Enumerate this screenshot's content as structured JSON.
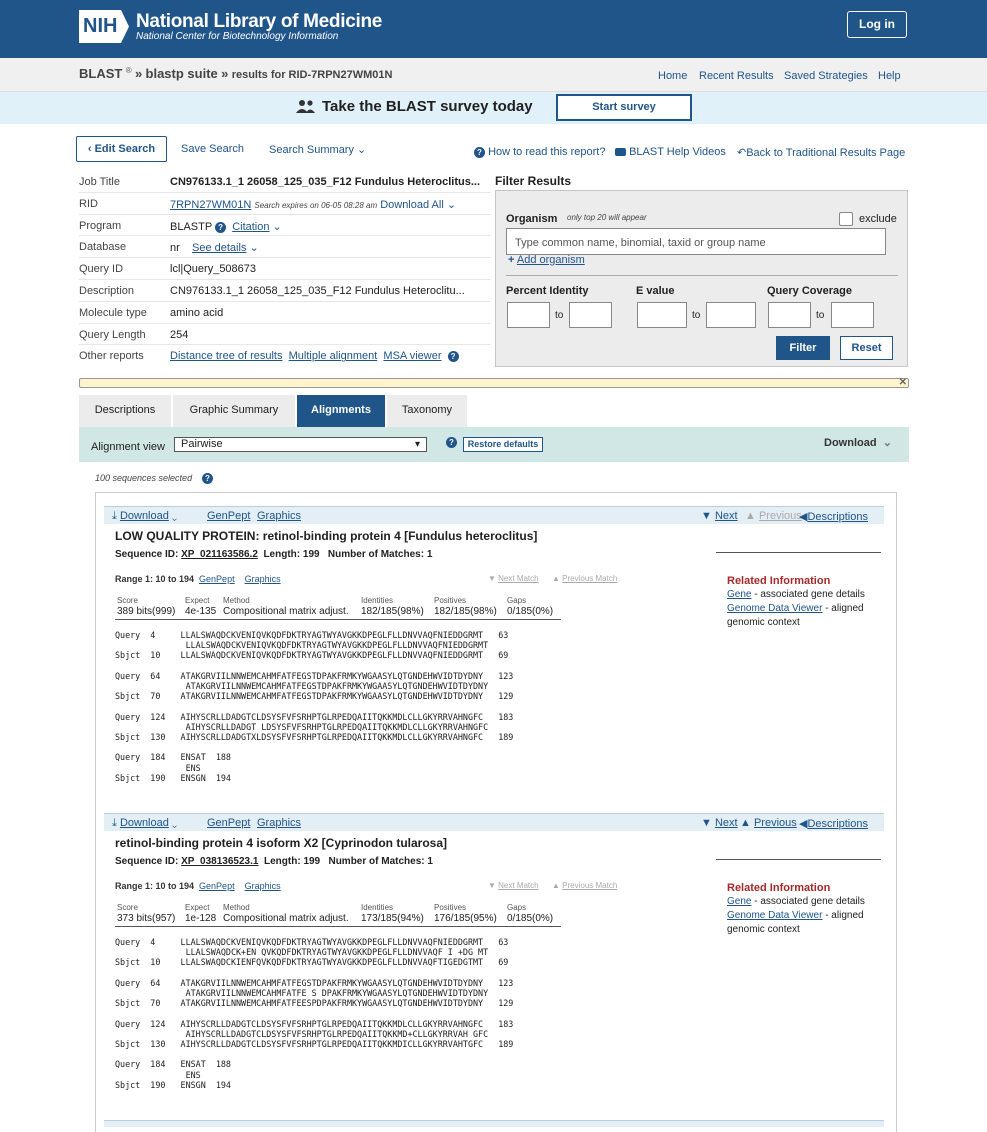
{
  "header": {
    "logo": "NIH",
    "title": "National Library of Medicine",
    "subtitle": "National Center for Biotechnology Information",
    "login": "Log in"
  },
  "breadcrumb": {
    "blast": "BLAST",
    "reg": "®",
    "sep1": "»",
    "suite": "blastp suite",
    "sep2": "»",
    "results": "results for RID-7RPN27WM01N"
  },
  "topnav": [
    "Home",
    "Recent Results",
    "Saved Strategies",
    "Help"
  ],
  "survey": {
    "text": "Take the BLAST survey today",
    "button": "Start survey"
  },
  "actions": {
    "edit": "‹ Edit Search",
    "save": "Save Search",
    "summary": "Search Summary",
    "howto": "How to read this report?",
    "videos": "BLAST Help Videos",
    "traditional": "Back to Traditional Results Page"
  },
  "job": {
    "labels": [
      "Job Title",
      "RID",
      "Program",
      "Database",
      "Query ID",
      "Description",
      "Molecule type",
      "Query Length",
      "Other reports"
    ],
    "title": "CN976133.1_1 26058_125_035_F12 Fundulus Heteroclitus...",
    "rid": "7RPN27WM01N",
    "rid_note": "Search expires on 06-05 08:28 am",
    "download_all": "Download All",
    "program": "BLASTP",
    "citation": "Citation",
    "database": "nr",
    "see_details": "See details",
    "query_id": "lcl|Query_508673",
    "description": "CN976133.1_1 26058_125_035_F12 Fundulus Heteroclitu...",
    "molecule": "amino acid",
    "length": "254",
    "reports": [
      "Distance tree of results",
      "Multiple alignment",
      "MSA viewer"
    ]
  },
  "filter": {
    "title": "Filter Results",
    "organism": "Organism",
    "top20": "only top 20 will appear",
    "exclude": "exclude",
    "placeholder": "Type common  name, binomial, taxid or group  name",
    "add": "Add organism",
    "identity": "Percent Identity",
    "evalue": "E value",
    "coverage": "Query Coverage",
    "to": "to",
    "filter_btn": "Filter",
    "reset_btn": "Reset"
  },
  "tabs": [
    "Descriptions",
    "Graphic Summary",
    "Alignments",
    "Taxonomy"
  ],
  "alignment_view": {
    "label": "Alignment view",
    "value": "Pairwise",
    "restore": "Restore defaults",
    "download": "Download"
  },
  "selected": "100 sequences selected",
  "hits": [
    {
      "download": "Download",
      "genpept": "GenPept",
      "graphics": "Graphics",
      "next": "Next",
      "previous": "Previous",
      "descriptions": "Descriptions",
      "title": "LOW QUALITY PROTEIN: retinol-binding protein 4 [Fundulus heteroclitus]",
      "seqid_label": "Sequence ID:",
      "seqid": "XP_021163586.2",
      "length_label": "Length:",
      "length": "199",
      "matches_label": "Number of Matches:",
      "matches": "1",
      "range": "Range 1: 10 to 194",
      "next_match": "Next Match",
      "prev_match": "Previous Match",
      "score_hdr": [
        "Score",
        "Expect",
        "Method",
        "Identities",
        "Positives",
        "Gaps"
      ],
      "score_val": [
        "389 bits(999)",
        "4e-135",
        "Compositional matrix adjust.",
        "182/185(98%)",
        "182/185(98%)",
        "0/185(0%)"
      ],
      "related": {
        "title": "Related Information",
        "gene": "Gene",
        "gene_desc": "- associated gene details",
        "gdv": "Genome Data Viewer",
        "gdv_desc": "- aligned genomic context"
      },
      "alignment": "Query  4     LLALSWAQDCKVENIQVKQDFDKTRYAGTWYAVGKKDPEGLFLLDNVVAQFNIEDDGRMT   63\n              LLALSWAQDCKVENIQVKQDFDKTRYAGTWYAVGKKDPEGLFLLDNVVAQFNIEDDGRMT\nSbjct  10    LLALSWAQDCKVENIQVKQDFDKTRYAGTWYAVGKKDPEGLFLLDNVVAQFNIEDDGRMT   69\n\nQuery  64    ATAKGRVIILNNWEMCAHMFATFEGSTDPAKFRMKYWGAASYLQTGNDEHWVIDTDYDNY   123\n              ATAKGRVIILNNWEMCAHMFATFEGSTDPAKFRMKYWGAASYLQTGNDEHWVIDTDYDNY\nSbjct  70    ATAKGRVIILNNWEMCAHMFATFEGSTDPAKFRMKYWGAASYLQTGNDEHWVIDTDYDNY   129\n\nQuery  124   AIHYSCRLLDADGTCLDSYSFVFSRHPTGLRPEDQAIITQKKMDLCLLGKYRRVAHNGFC   183\n              AIHYSCRLLDADGT LDSYSFVFSRHPTGLRPEDQAIITQKKMDLCLLGKYRRVAHNGFC\nSbjct  130   AIHYSCRLLDADGTXLDSYSFVFSRHPTGLRPEDQAIITQKKMDLCLLGKYRRVAHNGFC   189\n\nQuery  184   ENSAT  188\n              ENS\nSbjct  190   ENSGN  194"
    },
    {
      "download": "Download",
      "genpept": "GenPept",
      "graphics": "Graphics",
      "next": "Next",
      "previous": "Previous",
      "descriptions": "Descriptions",
      "title": "retinol-binding protein 4 isoform X2 [Cyprinodon tularosa]",
      "seqid_label": "Sequence ID:",
      "seqid": "XP_038136523.1",
      "length_label": "Length:",
      "length": "199",
      "matches_label": "Number of Matches:",
      "matches": "1",
      "range": "Range 1: 10 to 194",
      "next_match": "Next Match",
      "prev_match": "Previous Match",
      "score_hdr": [
        "Score",
        "Expect",
        "Method",
        "Identities",
        "Positives",
        "Gaps"
      ],
      "score_val": [
        "373 bits(957)",
        "1e-128",
        "Compositional matrix adjust.",
        "173/185(94%)",
        "176/185(95%)",
        "0/185(0%)"
      ],
      "related": {
        "title": "Related Information",
        "gene": "Gene",
        "gene_desc": "- associated gene details",
        "gdv": "Genome Data Viewer",
        "gdv_desc": "- aligned genomic context"
      },
      "alignment": "Query  4     LLALSWAQDCKVENIQVKQDFDKTRYAGTWYAVGKKDPEGLFLLDNVVAQFNIEDDGRMT   63\n              LLALSWAQDCK+EN QVKQDFDKTRYAGTWYAVGKKDPEGLFLLDNVVAQF I +DG MT\nSbjct  10    LLALSWAQDCKIENFQVKQDFDKTRYAGTWYAVGKKDPEGLFLLDNVVAQFTIGEDGTMT   69\n\nQuery  64    ATAKGRVIILNNWEMCAHMFATFEGSTDPAKFRMKYWGAASYLQTGNDEHWVIDTDYDNY   123\n              ATAKGRVIILNNWEMCAHMFATFE S DPAKFRMKYWGAASYLQTGNDEHWVIDTDYDNY\nSbjct  70    ATAKGRVIILNNWEMCAHMFATFEESPDPAKFRMKYWGAASYLQTGNDEHWVIDTDYDNY   129\n\nQuery  124   AIHYSCRLLDADGTCLDSYSFVFSRHPTGLRPEDQAIITQKKMDLCLLGKYRRVAHNGFC   183\n              AIHYSCRLLDADGTCLDSYSFVFSRHPTGLRPEDQAIITQKKMD+CLLGKYRRVAH GFC\nSbjct  130   AIHYSCRLLDADGTCLDSYSFVFSRHPTGLRPEDQAIITQKKMDICLLGKYRRVAHTGFC   189\n\nQuery  184   ENSAT  188\n              ENS\nSbjct  190   ENSGN  194"
    }
  ],
  "colors": {
    "brand": "#20558a",
    "survey_bg": "#e1f1f9",
    "related": "#a52a2a"
  }
}
